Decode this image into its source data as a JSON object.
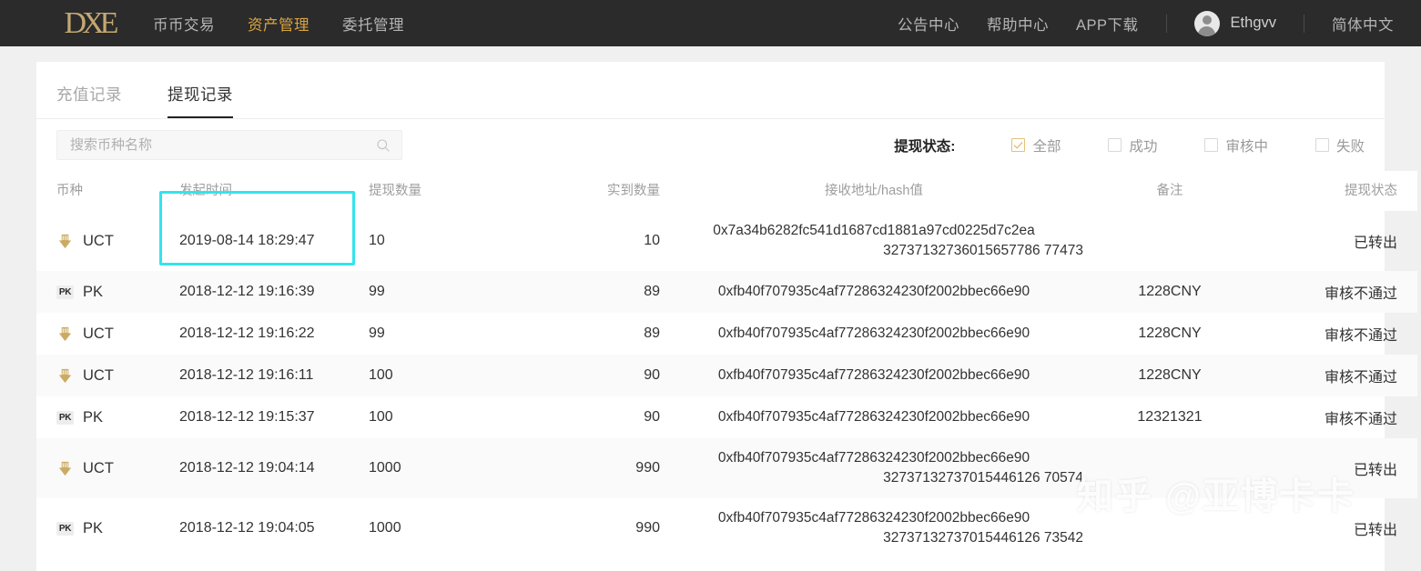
{
  "header": {
    "logo_text": "DXE",
    "nav_left": [
      {
        "label": "币币交易",
        "active": false
      },
      {
        "label": "资产管理",
        "active": true
      },
      {
        "label": "委托管理",
        "active": false
      }
    ],
    "nav_right": [
      {
        "label": "公告中心"
      },
      {
        "label": "帮助中心"
      },
      {
        "label": "APP下载"
      }
    ],
    "username": "Ethgvv",
    "language": "简体中文"
  },
  "tabs": [
    {
      "label": "充值记录",
      "active": false
    },
    {
      "label": "提现记录",
      "active": true
    }
  ],
  "search": {
    "placeholder": "搜索币种名称",
    "value": "",
    "icon": "search-icon"
  },
  "status_filter": {
    "label": "提现状态:",
    "options": [
      {
        "label": "全部",
        "checked": true
      },
      {
        "label": "成功",
        "checked": false
      },
      {
        "label": "审核中",
        "checked": false
      },
      {
        "label": "失败",
        "checked": false
      }
    ]
  },
  "table": {
    "columns": [
      "币种",
      "发起时间",
      "提现数量",
      "实到数量",
      "接收地址/hash值",
      "备注",
      "提现状态"
    ],
    "rows": [
      {
        "coin": "UCT",
        "coin_icon": "uct-coin-icon",
        "time": "2019-08-14 18:29:47",
        "amount": "10",
        "actual": "10",
        "address_line1": "0x7a34b6282fc541d1687cd1881a97cd0225d7c2ea",
        "address_line2": "32737132736015657786 77473",
        "memo": "",
        "status": "已转出"
      },
      {
        "coin": "PK",
        "coin_icon": "pk-coin-icon",
        "time": "2018-12-12 19:16:39",
        "amount": "99",
        "actual": "89",
        "address_line1": "0xfb40f707935c4af77286324230f2002bbec66e90",
        "address_line2": "",
        "memo": "1228CNY",
        "status": "审核不通过"
      },
      {
        "coin": "UCT",
        "coin_icon": "uct-coin-icon",
        "time": "2018-12-12 19:16:22",
        "amount": "99",
        "actual": "89",
        "address_line1": "0xfb40f707935c4af77286324230f2002bbec66e90",
        "address_line2": "",
        "memo": "1228CNY",
        "status": "审核不通过"
      },
      {
        "coin": "UCT",
        "coin_icon": "uct-coin-icon",
        "time": "2018-12-12 19:16:11",
        "amount": "100",
        "actual": "90",
        "address_line1": "0xfb40f707935c4af77286324230f2002bbec66e90",
        "address_line2": "",
        "memo": "1228CNY",
        "status": "审核不通过"
      },
      {
        "coin": "PK",
        "coin_icon": "pk-coin-icon",
        "time": "2018-12-12 19:15:37",
        "amount": "100",
        "actual": "90",
        "address_line1": "0xfb40f707935c4af77286324230f2002bbec66e90",
        "address_line2": "",
        "memo": "12321321",
        "status": "审核不通过"
      },
      {
        "coin": "UCT",
        "coin_icon": "uct-coin-icon",
        "time": "2018-12-12 19:04:14",
        "amount": "1000",
        "actual": "990",
        "address_line1": "0xfb40f707935c4af77286324230f2002bbec66e90",
        "address_line2": "32737132737015446126 70574",
        "memo": "",
        "status": "已转出"
      },
      {
        "coin": "PK",
        "coin_icon": "pk-coin-icon",
        "time": "2018-12-12 19:04:05",
        "amount": "1000",
        "actual": "990",
        "address_line1": "0xfb40f707935c4af77286324230f2002bbec66e90",
        "address_line2": "32737132737015446126 73542",
        "memo": "",
        "status": "已转出"
      }
    ]
  },
  "watermark": "知乎 @亚博卡卡",
  "colors": {
    "topbar_bg": "#2b2b2b",
    "accent_gold": "#d9a441",
    "highlight_cyan": "#33e4ec",
    "page_bg": "#f0f0f0"
  }
}
